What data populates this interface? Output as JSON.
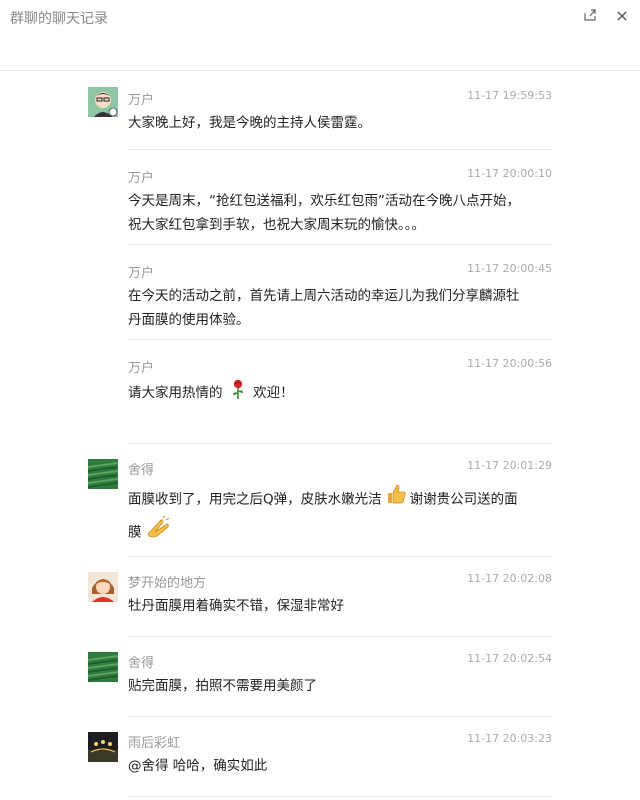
{
  "window": {
    "title": "群聊的聊天记录",
    "share_icon": "share-icon",
    "close_icon": "close-icon"
  },
  "messages": [
    {
      "sender": "万户",
      "time": "11-17 19:59:53",
      "text": "大家晚上好，我是今晚的主持人侯雷霆。"
    },
    {
      "sender": "万户",
      "time": "11-17 20:00:10",
      "text": "今天是周末，“抢红包送福利，欢乐红包雨”活动在今晚八点开始，祝大家红包拿到手软，也祝大家周末玩的愉快。。。"
    },
    {
      "sender": "万户",
      "time": "11-17 20:00:45",
      "text": "在今天的活动之前，首先请上周六活动的幸运儿为我们分享麟源牡丹面膜的使用体验。"
    },
    {
      "sender": "万户",
      "time": "11-17 20:00:56",
      "text_before": "请大家用热情的",
      "text_after": "欢迎！",
      "emoji": "rose-emoji"
    },
    {
      "sender": "舍得",
      "time": "11-17 20:01:29",
      "text_part1": "面膜收到了，用完之后Q弹，皮肤水嫩光洁",
      "text_part2": "谢谢贵公司送的面膜",
      "emoji1": "thumbs-up-emoji",
      "emoji2": "clap-emoji"
    },
    {
      "sender": "梦开始的地方",
      "time": "11-17 20:02:08",
      "text": "牡丹面膜用着确实不错，保湿非常好"
    },
    {
      "sender": "舍得",
      "time": "11-17 20:02:54",
      "text": "贴完面膜，拍照不需要用美颜了"
    },
    {
      "sender": "雨后彩虹",
      "time": "11-17 20:03:23",
      "text": "@舍得 哈哈，确实如此"
    }
  ]
}
